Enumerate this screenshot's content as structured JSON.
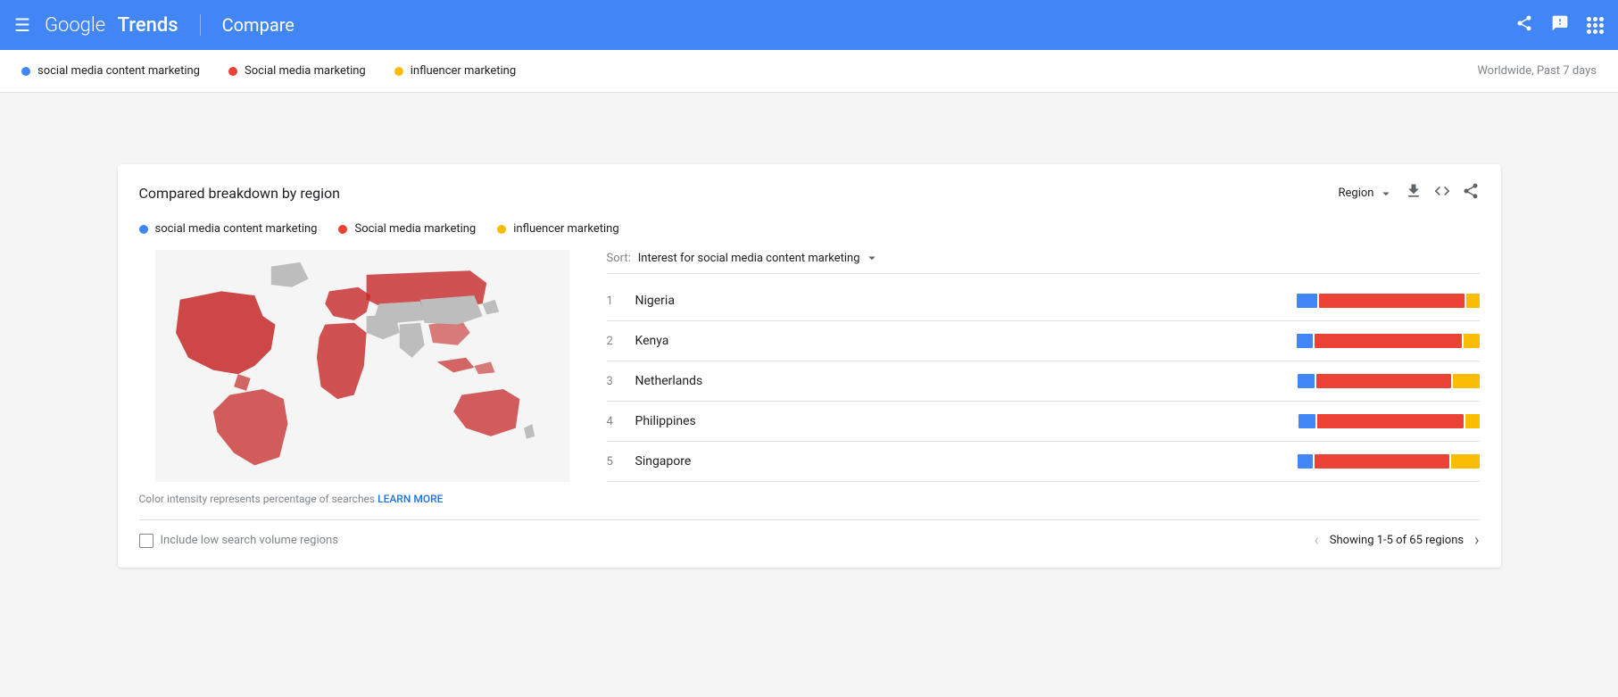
{
  "header": {
    "menu_label": "Menu",
    "logo_google": "Google",
    "logo_trends": "Trends",
    "compare_label": "Compare"
  },
  "top_legend": {
    "items": [
      {
        "id": "term1",
        "label": "social media content marketing",
        "color": "blue"
      },
      {
        "id": "term2",
        "label": "Social media marketing",
        "color": "red"
      },
      {
        "id": "term3",
        "label": "influencer marketing",
        "color": "yellow"
      }
    ],
    "scope": "Worldwide, Past 7 days"
  },
  "card": {
    "title": "Compared breakdown by region",
    "region_label": "Region",
    "legend": [
      {
        "id": "term1",
        "label": "social media content marketing",
        "color": "blue"
      },
      {
        "id": "term2",
        "label": "Social media marketing",
        "color": "red"
      },
      {
        "id": "term3",
        "label": "influencer marketing",
        "color": "yellow"
      }
    ],
    "sort_label": "Sort:",
    "sort_value": "Interest for social media content marketing",
    "rows": [
      {
        "rank": 1,
        "country": "Nigeria",
        "blue": 18,
        "red": 130,
        "yellow": 12
      },
      {
        "rank": 2,
        "country": "Kenya",
        "blue": 14,
        "red": 130,
        "yellow": 14
      },
      {
        "rank": 3,
        "country": "Netherlands",
        "blue": 14,
        "red": 110,
        "yellow": 22
      },
      {
        "rank": 4,
        "country": "Philippines",
        "blue": 14,
        "red": 120,
        "yellow": 12
      },
      {
        "rank": 5,
        "country": "Singapore",
        "blue": 12,
        "red": 105,
        "yellow": 22
      }
    ],
    "map_note": "Color intensity represents percentage of searches",
    "learn_more_label": "LEARN MORE",
    "checkbox_label": "Include low search volume regions",
    "pagination_text": "Showing 1-5 of 65 regions"
  }
}
